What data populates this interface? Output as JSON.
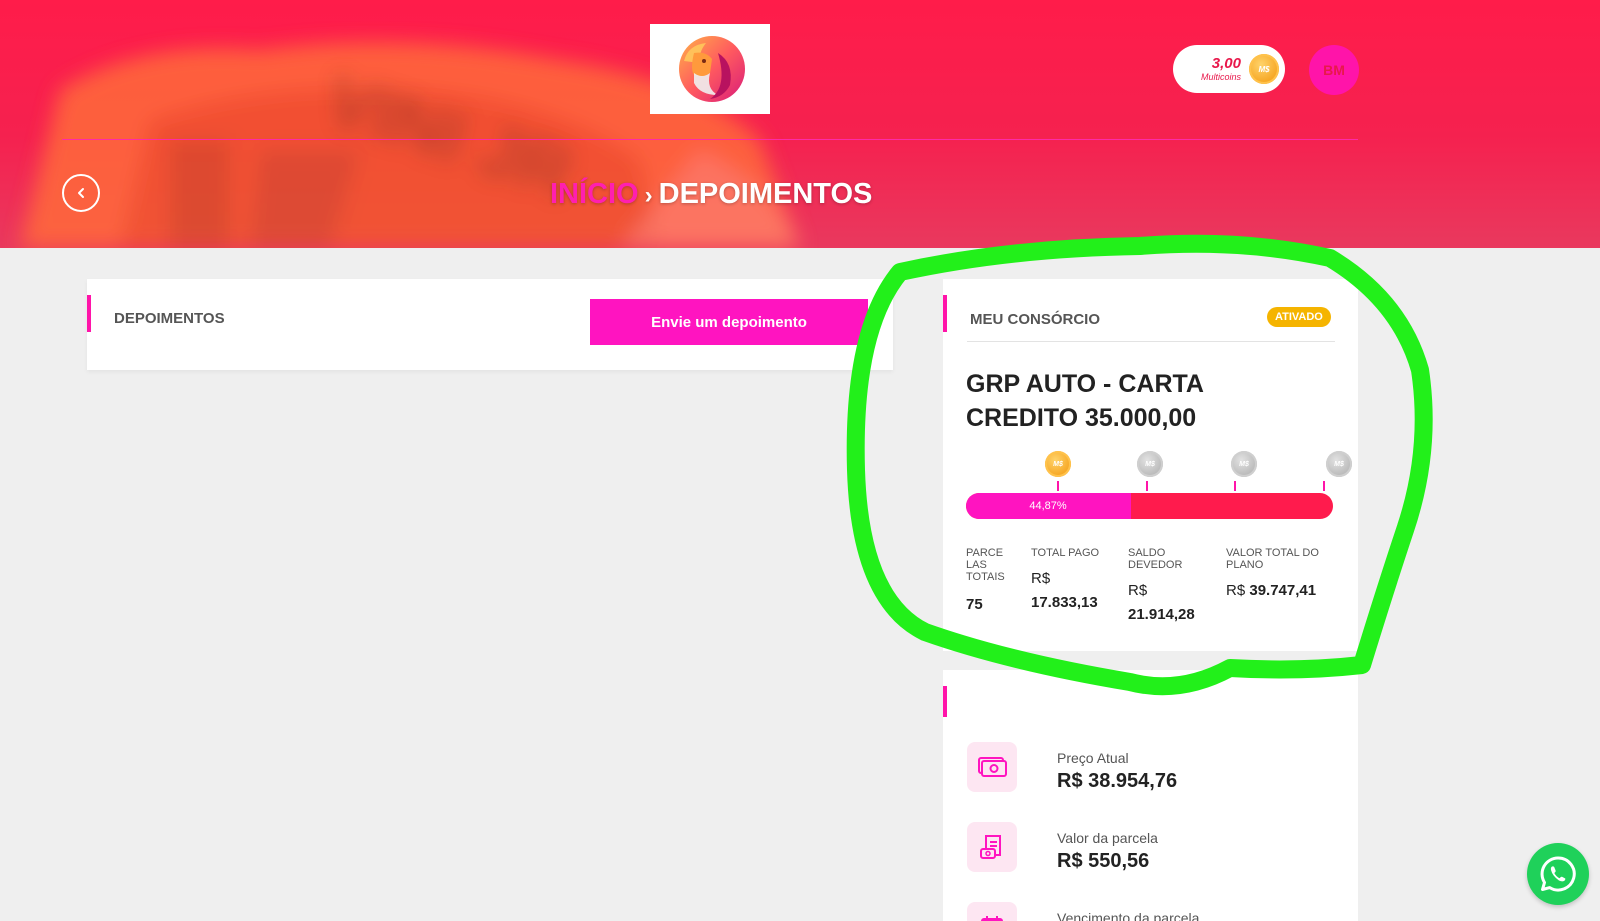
{
  "header": {
    "coins_value": "3,00",
    "coins_label": "Multicoins",
    "coin_symbol": "M$",
    "avatar_initials": "BM",
    "back_icon": "chevron-left-icon",
    "hero_shirt_text": "VINI JR"
  },
  "breadcrumb": {
    "home": "INÍCIO",
    "separator": "›",
    "current": "DEPOIMENTOS"
  },
  "testimonials": {
    "title": "DEPOIMENTOS",
    "button_label": "Envie um depoimento"
  },
  "consortium": {
    "title": "MEU CONSÓRCIO",
    "status": "ATIVADO",
    "plan_name": "GRP AUTO - CARTA CREDITO 35.000,00",
    "progress_label": "44,87%",
    "progress_fraction": 0.4487,
    "milestones": [
      "gold",
      "grey",
      "grey",
      "grey"
    ],
    "stats": [
      {
        "label": "PARCE LAS TOTAIS",
        "prefix": "",
        "value": "75"
      },
      {
        "label": "TOTAL PAGO",
        "prefix": "R$",
        "value": "17.833,13"
      },
      {
        "label": "SALDO DEVEDOR",
        "prefix": "R$",
        "value": "21.914,28"
      },
      {
        "label": "VALOR TOTAL DO PLANO",
        "prefix": "R$",
        "value": "39.747,41"
      }
    ]
  },
  "info": {
    "items": [
      {
        "label": "Preço Atual",
        "value": "R$ 38.954,76",
        "icon": "money-icon"
      },
      {
        "label": "Valor da parcela",
        "value": "R$ 550,56",
        "icon": "invoice-icon"
      },
      {
        "label": "Vencimento da parcela",
        "value": "",
        "icon": "calendar-icon"
      }
    ]
  },
  "colors": {
    "brand_pink": "#ff14c0",
    "brand_red": "#ff1b4d",
    "badge_yellow": "#f5b400",
    "whatsapp_green": "#1fd15a",
    "highlight_green": "#22f01a"
  }
}
